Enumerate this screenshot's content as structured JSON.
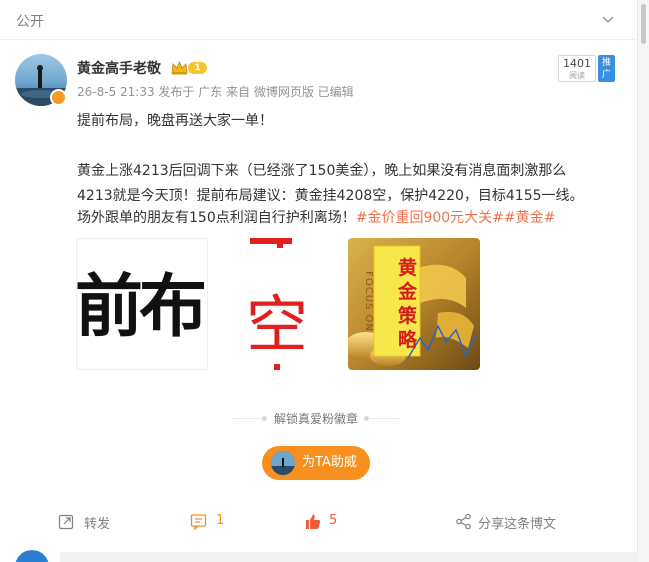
{
  "header": {
    "visibility_label": "公开"
  },
  "post": {
    "author": "黄金高手老敬",
    "level": "1",
    "meta": "26-8-5 21:33 发布于 广东 来自 微博网页版 已编辑",
    "read_count": "1401",
    "read_label": "阅读",
    "promo_label": "推广",
    "line1": "提前布局，晚盘再送大家一单！",
    "line2": "黄金上涨4213后回调下来（已经涨了150美金），晚上如果没有消息面刺激那么",
    "line3": "4213就是今天顶！提前布局建议：黄金挂4208空，保护4220，目标4155一线。",
    "line4_plain": "场外跟单的朋友有150点利润自行护利离场！",
    "hashtag1": "#金价重回900元大关#",
    "hashtag2": "#黄金#"
  },
  "images": {
    "img1_text": "前布",
    "img2_text": "空",
    "img3_title": "黄金策略",
    "img3_side": "FOCUS ON"
  },
  "unlock": {
    "label": "解锁真爱粉徽章"
  },
  "support": {
    "label": "为TA助威"
  },
  "actions": {
    "repost": "转发",
    "comment_count": "1",
    "like_count": "5",
    "share": "分享这条博文"
  },
  "colors": {
    "accent": "#eb7350",
    "button": "#f7901e",
    "promo": "#3b8fe0"
  }
}
